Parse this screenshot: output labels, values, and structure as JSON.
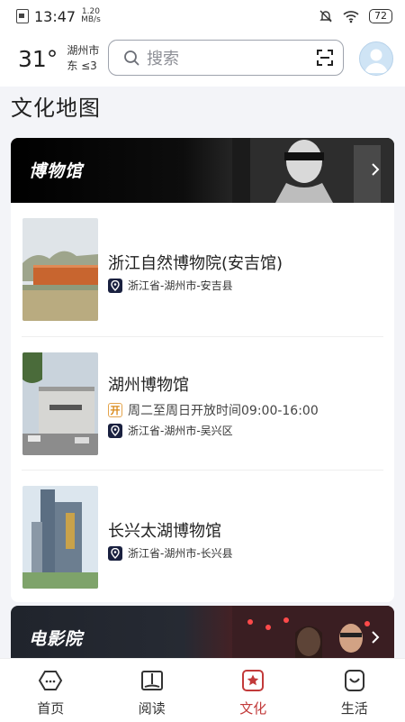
{
  "status_bar": {
    "time": "13:47",
    "net_speed_value": "1.20",
    "net_speed_unit": "MB/s",
    "battery": "72"
  },
  "header": {
    "temperature": "31°",
    "city": "湖州市",
    "wind": "东  ≤3",
    "search_placeholder": "搜索"
  },
  "page_title": "文化地图",
  "museum_section": {
    "title": "博物馆",
    "items": [
      {
        "name": "浙江自然博物院(安吉馆)",
        "location": "浙江省-湖州市-安吉县"
      },
      {
        "name": "湖州博物馆",
        "open_badge": "开",
        "hours": "周二至周日开放时间09:00-16:00",
        "location": "浙江省-湖州市-吴兴区"
      },
      {
        "name": "长兴太湖博物馆",
        "location": "浙江省-湖州市-长兴县"
      }
    ]
  },
  "cinema_section": {
    "title": "电影院"
  },
  "bottom_nav": [
    {
      "label": "首页",
      "icon": "home-icon"
    },
    {
      "label": "阅读",
      "icon": "book-icon"
    },
    {
      "label": "文化",
      "icon": "culture-icon",
      "active": true
    },
    {
      "label": "生活",
      "icon": "life-icon"
    }
  ],
  "colors": {
    "accent": "#c23a3a",
    "location_badge": "#1a2140",
    "background": "#f3f4f8"
  }
}
